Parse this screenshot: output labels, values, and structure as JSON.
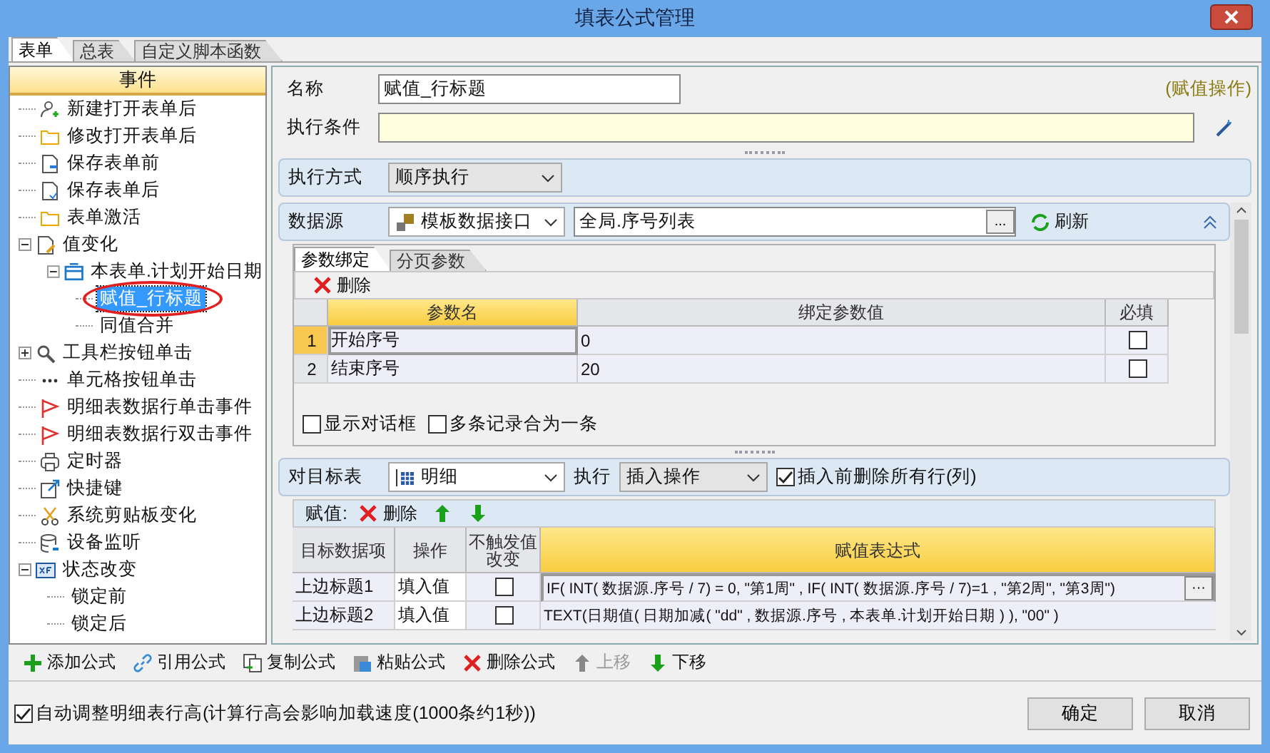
{
  "window": {
    "title": "填表公式管理"
  },
  "tabs": [
    {
      "label": "表单",
      "selected": true
    },
    {
      "label": "总表",
      "selected": false
    },
    {
      "label": "自定义脚本函数",
      "selected": false
    }
  ],
  "tree": {
    "header": "事件",
    "items": [
      {
        "label": "新建打开表单后",
        "selected": false
      },
      {
        "label": "修改打开表单后",
        "selected": false
      },
      {
        "label": "保存表单前",
        "selected": false
      },
      {
        "label": "保存表单后",
        "selected": false
      },
      {
        "label": "表单激活",
        "selected": false
      },
      {
        "label": "值变化",
        "selected": false,
        "expanded": true,
        "children": [
          {
            "label": "本表单.计划开始日期",
            "selected": false,
            "expanded": true,
            "children": [
              {
                "label": "赋值_行标题",
                "selected": true,
                "circled": true
              },
              {
                "label": "同值合并",
                "selected": false
              }
            ]
          }
        ]
      },
      {
        "label": "工具栏按钮单击",
        "selected": false,
        "expanded": false
      },
      {
        "label": "单元格按钮单击",
        "selected": false
      },
      {
        "label": "明细表数据行单击事件",
        "selected": false
      },
      {
        "label": "明细表数据行双击事件",
        "selected": false
      },
      {
        "label": "定时器",
        "selected": false
      },
      {
        "label": "快捷键",
        "selected": false
      },
      {
        "label": "系统剪贴板变化",
        "selected": false
      },
      {
        "label": "设备监听",
        "selected": false
      },
      {
        "label": "状态改变",
        "selected": false,
        "expanded": true,
        "children": [
          {
            "label": "锁定前",
            "selected": false
          },
          {
            "label": "锁定后",
            "selected": false
          }
        ]
      }
    ]
  },
  "form": {
    "name_label": "名称",
    "name_value": "赋值_行标题",
    "type_tag": "(赋值操作)",
    "condition_label": "执行条件"
  },
  "exec_mode": {
    "label": "执行方式",
    "value": "顺序执行"
  },
  "datasource": {
    "label": "数据源",
    "source": "模板数据接口",
    "path": "全局.序号列表",
    "browse": "...",
    "refresh": "刷新"
  },
  "param_tabs": [
    {
      "label": "参数绑定",
      "selected": true
    },
    {
      "label": "分页参数",
      "selected": false
    }
  ],
  "param_delete": "删除",
  "param_table": {
    "columns": [
      "参数名",
      "绑定参数值",
      "必填"
    ],
    "rows": [
      {
        "index": "1",
        "name": "开始序号",
        "value": "0",
        "required": false,
        "selected": true
      },
      {
        "index": "2",
        "name": "结束序号",
        "value": "20",
        "required": false,
        "selected": false
      }
    ]
  },
  "param_options": [
    {
      "label": "显示对话框",
      "checked": false
    },
    {
      "label": "多条记录合为一条",
      "checked": false
    }
  ],
  "target": {
    "label": "对目标表",
    "table": "明细",
    "exec_label": "执行",
    "exec_value": "插入操作",
    "clear_before": {
      "label": "插入前删除所有行(列)",
      "checked": true
    }
  },
  "assign": {
    "label": "赋值:",
    "delete": "删除"
  },
  "assign_table": {
    "columns": [
      "目标数据项",
      "操作",
      "不触发值改变",
      "赋值表达式"
    ],
    "rows": [
      {
        "target": "上边标题1",
        "op": "填入值",
        "no_trigger": false,
        "expr": "IF( INT( 数据源.序号 / 7) = 0, \"第1周\" , IF( INT( 数据源.序号 / 7)=1 , \"第2周\", \"第3周\")",
        "selected": true,
        "edit_button": "···"
      },
      {
        "target": "上边标题2",
        "op": "填入值",
        "no_trigger": false,
        "expr": "TEXT(日期值( 日期加减( \"dd\" , 数据源.序号 , 本表单.计划开始日期 ) ), \"00\" )",
        "selected": false
      }
    ]
  },
  "toolbar": [
    {
      "label": "添加公式",
      "disabled": false
    },
    {
      "label": "引用公式",
      "disabled": false
    },
    {
      "label": "复制公式",
      "disabled": false
    },
    {
      "label": "粘贴公式",
      "disabled": false
    },
    {
      "label": "删除公式",
      "disabled": false
    },
    {
      "label": "上移",
      "disabled": true
    },
    {
      "label": "下移",
      "disabled": false
    }
  ],
  "footer": {
    "auto_height": {
      "label": "自动调整明细表行高(计算行高会影响加载速度(1000条约1秒))",
      "checked": true
    },
    "buttons": [
      "确定",
      "取消"
    ]
  }
}
